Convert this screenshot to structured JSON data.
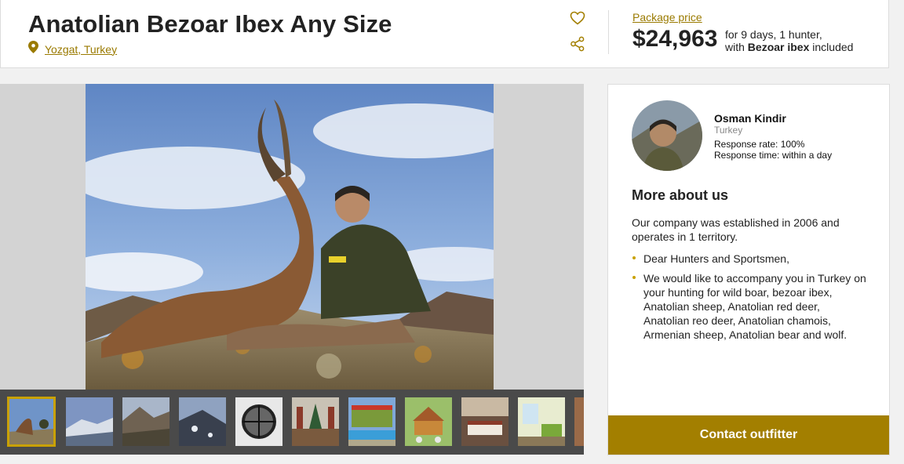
{
  "header": {
    "title": "Anatolian Bezoar Ibex Any Size",
    "location": "Yozgat, Turkey",
    "price_label": "Package price",
    "price": "$24,963",
    "price_line1": "for 9 days, 1 hunter,",
    "price_line2_pre": "with ",
    "price_line2_bold": "Bezoar ibex",
    "price_line2_post": " included"
  },
  "icons": {
    "favorite": "heart-icon",
    "share": "share-icon",
    "location": "location-pin-icon"
  },
  "gallery": {
    "thumbnail_count": 11,
    "active_index": 0
  },
  "outfitter": {
    "name": "Osman Kindir",
    "country": "Turkey",
    "response_rate": "Response rate: 100%",
    "response_time": "Response time: within a day",
    "more_heading": "More about us",
    "intro": "Our company was established in 2006 and operates in 1 territory.",
    "bullets": [
      "Dear Hunters and Sportsmen,",
      "We would like to accompany you in Turkey on your hunting for wild boar, bezoar ibex, Anatolian sheep, Anatolian red deer, Anatolian reo deer, Anatolian chamois, Armenian sheep, Anatolian bear and wolf."
    ],
    "contact_label": "Contact outfitter"
  },
  "colors": {
    "accent": "#a37f00",
    "link": "#9a7a00",
    "thumb_strip": "#4a4a4a"
  }
}
